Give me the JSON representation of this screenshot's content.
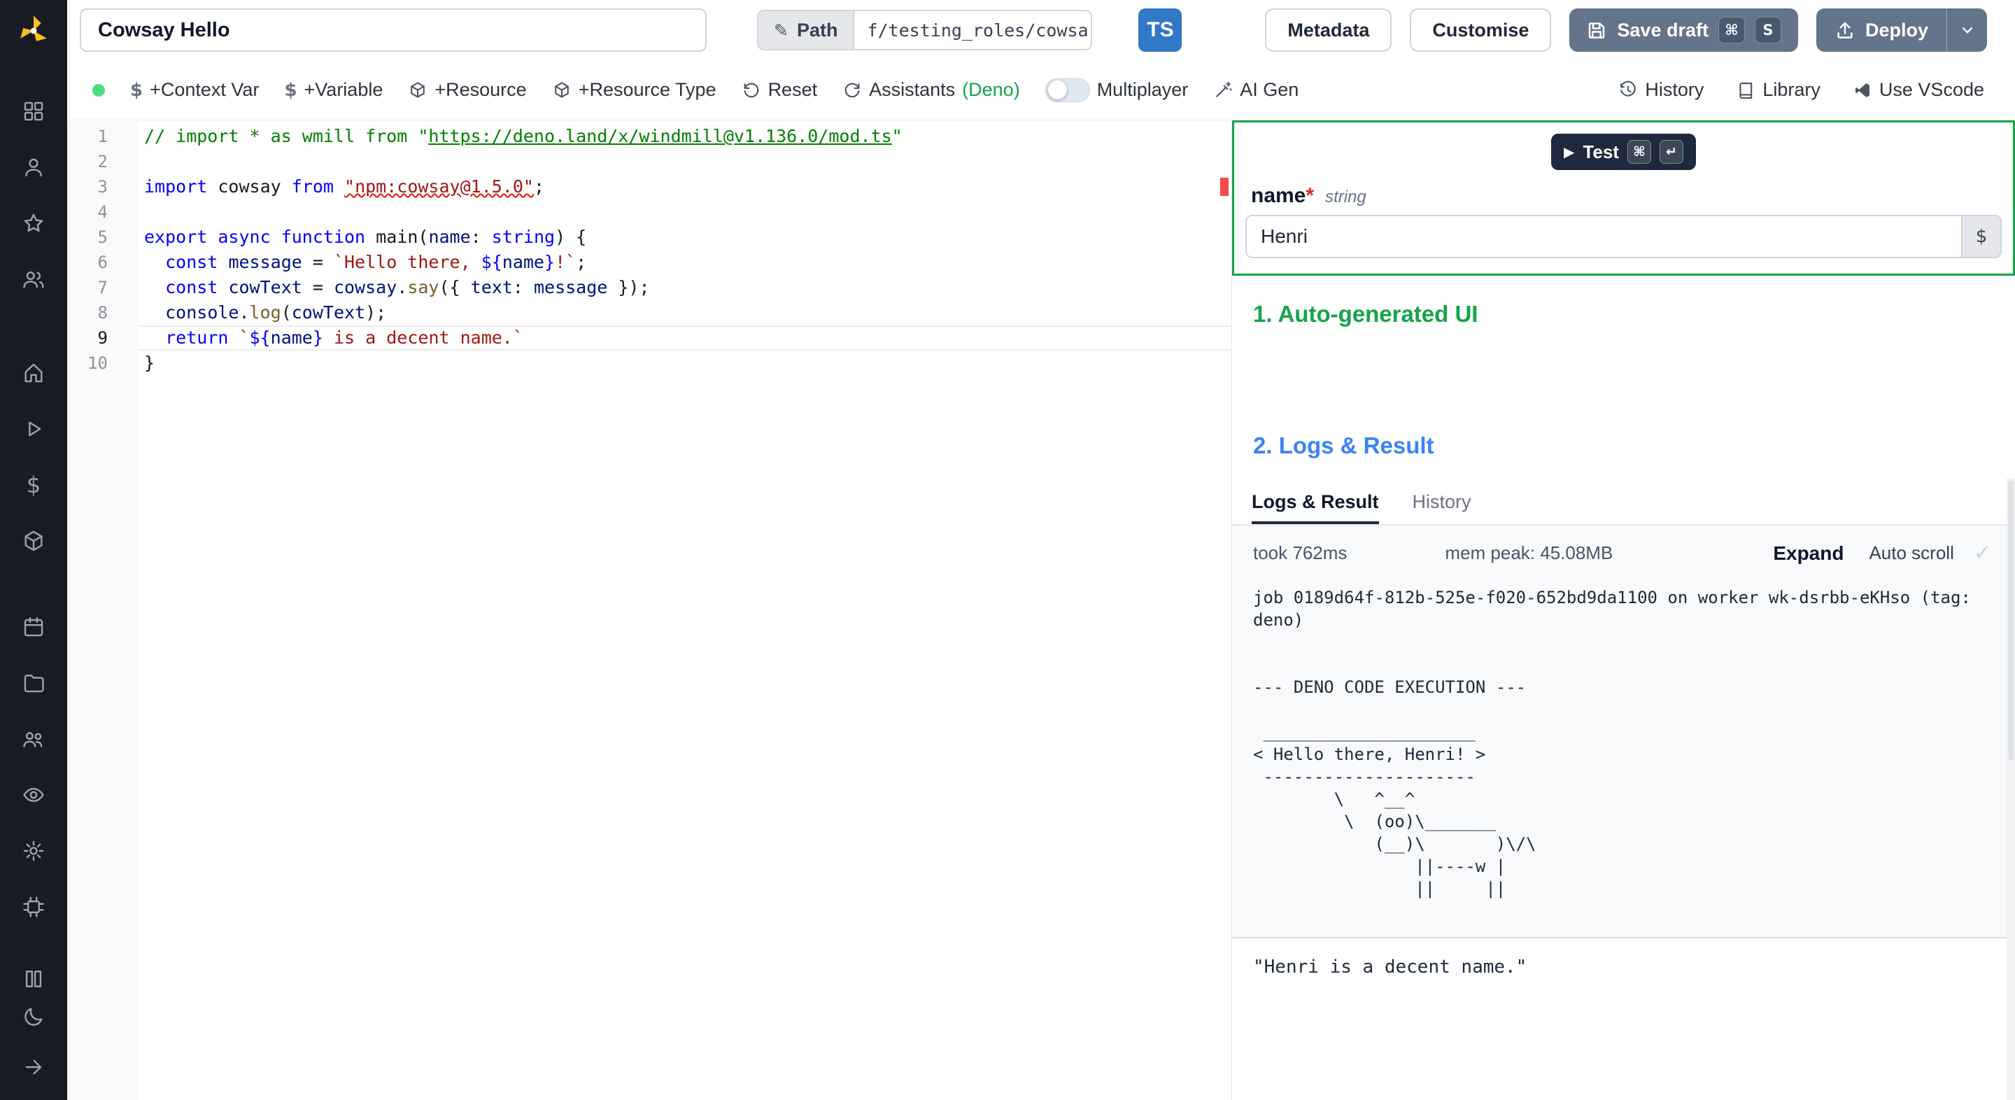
{
  "colors": {
    "sidebar_bg": "#171c24",
    "primary_button": "#64748b",
    "ts_badge": "#3178c6",
    "success_green": "#16a34a",
    "info_blue": "#3b82f6",
    "error_red": "#e51400",
    "online_dot": "#4ade80",
    "keyword_blue": "#0000ff",
    "string_red": "#a31515",
    "comment_green": "#008000"
  },
  "sidebar": {
    "logo": "windmill-logo",
    "groups": [
      [
        "apps-grid",
        "user",
        "star",
        "users"
      ],
      [
        "home",
        "play",
        "dollar",
        "cube"
      ],
      [
        "calendar",
        "folder",
        "user-group",
        "eye",
        "gear",
        "worker"
      ],
      [
        "docs",
        "moon"
      ]
    ],
    "collapse": "collapse-arrow"
  },
  "topbar": {
    "script_name": "Cowsay Hello",
    "path_label": "Path",
    "path_value": "f/testing_roles/cowsa",
    "lang_badge": "TS",
    "metadata_label": "Metadata",
    "customise_label": "Customise",
    "save_draft_label": "Save draft",
    "save_kbd": [
      "⌘",
      "S"
    ],
    "deploy_label": "Deploy"
  },
  "toolbar": {
    "status_dot": "online",
    "context_var": "+Context Var",
    "variable": "+Variable",
    "resource": "+Resource",
    "resource_type": "+Resource Type",
    "reset": "Reset",
    "assistants": "Assistants ",
    "assistants_lang": "(Deno)",
    "multiplayer": "Multiplayer",
    "multiplayer_on": false,
    "ai_gen": "AI Gen",
    "history": "History",
    "library": "Library",
    "use_vscode": "Use VScode"
  },
  "editor": {
    "active_line": 9,
    "lines": [
      [
        [
          "// import * as wmill from \"",
          "cm"
        ],
        [
          "https://deno.land/x/windmill@v1.136.0/mod.ts",
          "cm lnk"
        ],
        [
          "\"",
          "cm"
        ]
      ],
      [],
      [
        [
          "import",
          "kw"
        ],
        [
          " cowsay ",
          "pl"
        ],
        [
          "from",
          "kw"
        ],
        [
          " ",
          "pl"
        ],
        [
          "\"npm:cowsay@1.5.0\"",
          "str sq"
        ],
        [
          ";",
          "pl"
        ]
      ],
      [],
      [
        [
          "export",
          "kw"
        ],
        [
          " ",
          "pl"
        ],
        [
          "async",
          "kw"
        ],
        [
          " ",
          "pl"
        ],
        [
          "function",
          "kw"
        ],
        [
          " main(",
          "pl"
        ],
        [
          "name",
          "vr"
        ],
        [
          ": ",
          "pl"
        ],
        [
          "string",
          "kw"
        ],
        [
          ") {",
          "pl"
        ]
      ],
      [
        [
          "  ",
          "pl"
        ],
        [
          "const",
          "kw"
        ],
        [
          " ",
          "pl"
        ],
        [
          "message",
          "vr"
        ],
        [
          " = ",
          "pl"
        ],
        [
          "`Hello there, ",
          "str"
        ],
        [
          "${",
          "kw"
        ],
        [
          "name",
          "vr"
        ],
        [
          "}",
          "kw"
        ],
        [
          "!`",
          "str"
        ],
        [
          ";",
          "pl"
        ]
      ],
      [
        [
          "  ",
          "pl"
        ],
        [
          "const",
          "kw"
        ],
        [
          " ",
          "pl"
        ],
        [
          "cowText",
          "vr"
        ],
        [
          " = ",
          "pl"
        ],
        [
          "cowsay",
          "vr"
        ],
        [
          ".",
          "pl"
        ],
        [
          "say",
          "fn"
        ],
        [
          "({ ",
          "pl"
        ],
        [
          "text",
          "vr"
        ],
        [
          ": ",
          "pl"
        ],
        [
          "message",
          "vr"
        ],
        [
          " });",
          "pl"
        ]
      ],
      [
        [
          "  ",
          "pl"
        ],
        [
          "console",
          "vr"
        ],
        [
          ".",
          "pl"
        ],
        [
          "log",
          "fn"
        ],
        [
          "(",
          "pl"
        ],
        [
          "cowText",
          "vr"
        ],
        [
          ");",
          "pl"
        ]
      ],
      [
        [
          "  ",
          "pl"
        ],
        [
          "return",
          "kw"
        ],
        [
          " ",
          "pl"
        ],
        [
          "`",
          "str"
        ],
        [
          "${",
          "kw"
        ],
        [
          "name",
          "vr"
        ],
        [
          "}",
          "kw"
        ],
        [
          " is a decent name.`",
          "str"
        ]
      ],
      [
        [
          "}",
          "pl"
        ]
      ]
    ]
  },
  "preview": {
    "test_label": "Test",
    "test_kbd": [
      "⌘",
      "↵"
    ],
    "field_name": "name",
    "required_mark": "*",
    "field_type": "string",
    "field_value": "Henri",
    "dollar_button": "$",
    "section_ui": "1. Auto-generated UI",
    "section_logs": "2. Logs & Result",
    "tabs": [
      "Logs & Result",
      "History"
    ],
    "active_tab": "Logs & Result",
    "took": "took 762ms",
    "mem": "mem peak: 45.08MB",
    "expand_label": "Expand",
    "autoscroll_label": "Auto scroll",
    "log_lines": [
      "job 0189d64f-812b-525e-f020-652bd9da1100 on worker wk-dsrbb-eKHso (tag:",
      "deno)",
      "",
      "",
      "--- DENO CODE EXECUTION ---",
      "",
      " _____________________",
      "< Hello there, Henri! >",
      " ---------------------",
      "        \\   ^__^",
      "         \\  (oo)\\_______",
      "            (__)\\       )\\/\\",
      "                ||----w |",
      "                ||     ||"
    ],
    "result": "\"Henri is a decent name.\""
  }
}
